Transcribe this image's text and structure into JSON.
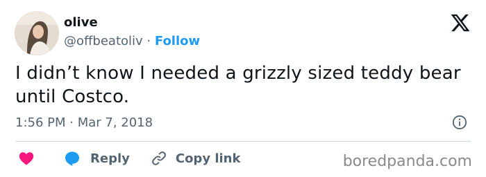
{
  "author": {
    "name": "olive",
    "handle": "@offbeatoliv",
    "separator": "·",
    "follow_label": "Follow"
  },
  "tweet": {
    "text": "I didn’t know I needed a grizzly sized teddy bear until Costco.",
    "timestamp": "1:56 PM · Mar 7, 2018"
  },
  "actions": {
    "reply_label": "Reply",
    "copy_link_label": "Copy link"
  },
  "watermark": "boredpanda.com",
  "icons": {
    "platform_logo": "x-logo-icon",
    "info": "info-icon",
    "like": "heart-icon",
    "reply": "speech-bubble-icon",
    "copy_link": "link-icon"
  },
  "colors": {
    "text": "#0f1419",
    "muted": "#536471",
    "link_blue": "#1d9bf0",
    "heart_pink": "#f91880",
    "divider": "#cfd9de",
    "watermark": "#8a8a8a"
  }
}
